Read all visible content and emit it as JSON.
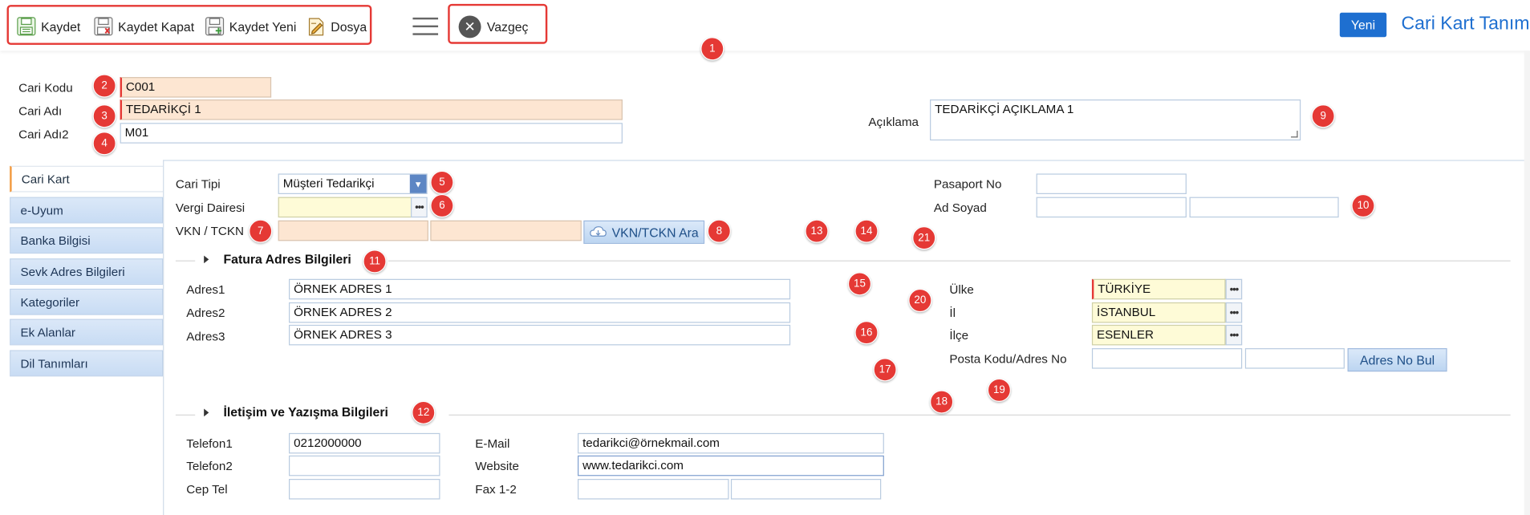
{
  "toolbar": {
    "save_label": "Kaydet",
    "save_close_label": "Kaydet Kapat",
    "save_new_label": "Kaydet Yeni",
    "file_label": "Dosya",
    "cancel_label": "Vazgeç"
  },
  "header": {
    "new_label": "Yeni",
    "title": "Cari Kart Tanım"
  },
  "colors": {
    "accent": "#1e6fd0",
    "badge": "#e53935",
    "required_field": "#fde6d2",
    "lookup_field": "#fefbd7"
  },
  "badges": [
    "1",
    "2",
    "3",
    "4",
    "5",
    "6",
    "7",
    "8",
    "9",
    "10",
    "11",
    "12",
    "13",
    "14",
    "15",
    "16",
    "17",
    "18",
    "19",
    "20",
    "21"
  ],
  "top_form": {
    "cari_kodu_label": "Cari Kodu",
    "cari_kodu_value": "C001",
    "cari_adi_label": "Cari Adı",
    "cari_adi_value": "TEDARİKÇİ 1",
    "cari_adi2_label": "Cari Adı2",
    "cari_adi2_value": "M01",
    "aciklama_label": "Açıklama",
    "aciklama_value": "TEDARİKÇİ AÇIKLAMA 1"
  },
  "sidebar": {
    "items": [
      {
        "label": "Cari Kart"
      },
      {
        "label": "e-Uyum"
      },
      {
        "label": "Banka Bilgisi"
      },
      {
        "label": "Sevk Adres Bilgileri"
      },
      {
        "label": "Kategoriler"
      },
      {
        "label": "Ek Alanlar"
      },
      {
        "label": "Dil Tanımları"
      }
    ]
  },
  "cari_kart": {
    "cari_tipi_label": "Cari Tipi",
    "cari_tipi_value": "Müşteri Tedarikçi",
    "vergi_dairesi_label": "Vergi Dairesi",
    "vergi_dairesi_value": "",
    "vkn_label": "VKN / TCKN",
    "vkn_value": "",
    "vkn_value2": "",
    "vkn_button": "VKN/TCKN Ara",
    "pasaport_label": "Pasaport No",
    "pasaport_value": "",
    "ad_soyad_label": "Ad Soyad",
    "ad_value": "",
    "soyad_value": ""
  },
  "fatura": {
    "section_title": "Fatura Adres Bilgileri",
    "adres1_label": "Adres1",
    "adres1_value": "ÖRNEK ADRES 1",
    "adres2_label": "Adres2",
    "adres2_value": "ÖRNEK ADRES 2",
    "adres3_label": "Adres3",
    "adres3_value": "ÖRNEK ADRES 3",
    "ulke_label": "Ülke",
    "ulke_value": "TÜRKİYE",
    "il_label": "İl",
    "il_value": "İSTANBUL",
    "ilce_label": "İlçe",
    "ilce_value": "ESENLER",
    "posta_label": "Posta Kodu/Adres No",
    "posta_value": "",
    "adres_no_value": "",
    "adres_no_button": "Adres No Bul"
  },
  "iletisim": {
    "section_title": "İletişim ve Yazışma Bilgileri",
    "telefon1_label": "Telefon1",
    "telefon1_value": "0212000000",
    "telefon2_label": "Telefon2",
    "telefon2_value": "",
    "cep_label": "Cep Tel",
    "cep_value": "",
    "email_label": "E-Mail",
    "email_value": "tedarikci@örnekmail.com",
    "website_label": "Website",
    "website_value": "www.tedarikci.com",
    "fax_label": "Fax 1-2",
    "fax1_value": "",
    "fax2_value": ""
  }
}
